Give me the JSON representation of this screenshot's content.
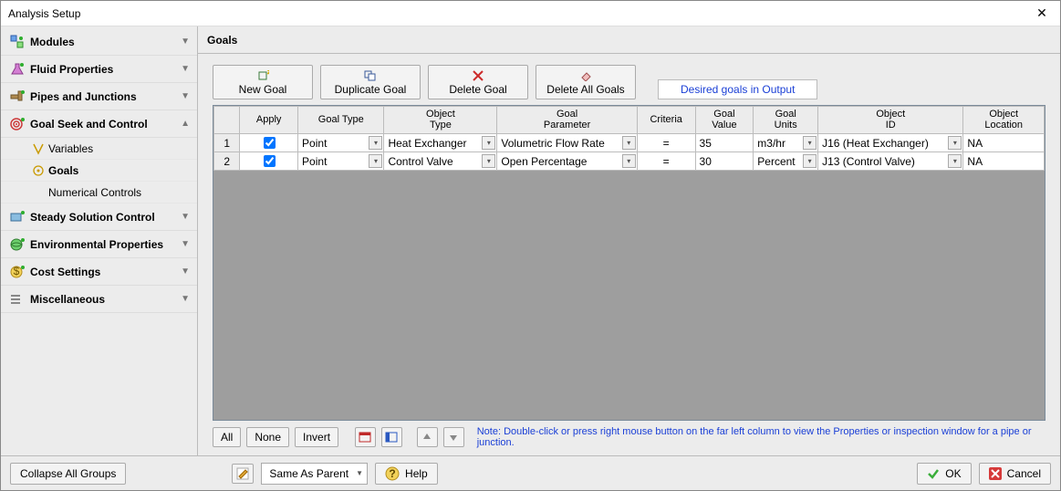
{
  "window": {
    "title": "Analysis Setup"
  },
  "sidebar": {
    "groups": [
      {
        "label": "Modules",
        "expanded": false
      },
      {
        "label": "Fluid Properties",
        "expanded": false
      },
      {
        "label": "Pipes and Junctions",
        "expanded": false
      },
      {
        "label": "Goal Seek and Control",
        "expanded": true
      },
      {
        "label": "Steady Solution Control",
        "expanded": false
      },
      {
        "label": "Environmental Properties",
        "expanded": false
      },
      {
        "label": "Cost Settings",
        "expanded": false
      },
      {
        "label": "Miscellaneous",
        "expanded": false
      }
    ],
    "gsc_sub": [
      {
        "label": "Variables",
        "selected": false
      },
      {
        "label": "Goals",
        "selected": true
      },
      {
        "label": "Numerical Controls",
        "selected": false
      }
    ]
  },
  "main": {
    "header": "Goals",
    "buttons": {
      "new": "New Goal",
      "duplicate": "Duplicate Goal",
      "delete": "Delete Goal",
      "delete_all": "Delete All Goals"
    },
    "link": "Desired goals in Output",
    "columns": {
      "apply": "Apply",
      "goal_type": "Goal Type",
      "object_type": "Object\nType",
      "goal_parameter": "Goal\nParameter",
      "criteria": "Criteria",
      "goal_value": "Goal\nValue",
      "goal_units": "Goal\nUnits",
      "object_id": "Object\nID",
      "object_location": "Object\nLocation"
    },
    "rows": [
      {
        "n": "1",
        "apply": true,
        "goal_type": "Point",
        "object_type": "Heat Exchanger",
        "goal_parameter": "Volumetric Flow Rate",
        "criteria": "=",
        "goal_value": "35",
        "goal_units": "m3/hr",
        "object_id": "J16 (Heat Exchanger)",
        "object_location": "NA"
      },
      {
        "n": "2",
        "apply": true,
        "goal_type": "Point",
        "object_type": "Control Valve",
        "goal_parameter": "Open Percentage",
        "criteria": "=",
        "goal_value": "30",
        "goal_units": "Percent",
        "object_id": "J13 (Control Valve)",
        "object_location": "NA"
      }
    ],
    "util": {
      "all": "All",
      "none": "None",
      "invert": "Invert"
    },
    "note": "Note: Double-click or press right mouse button on the far left column to view the Properties or inspection window for a pipe or junction."
  },
  "footer": {
    "collapse": "Collapse All Groups",
    "same_as_parent": "Same As Parent",
    "help": "Help",
    "ok": "OK",
    "cancel": "Cancel"
  }
}
